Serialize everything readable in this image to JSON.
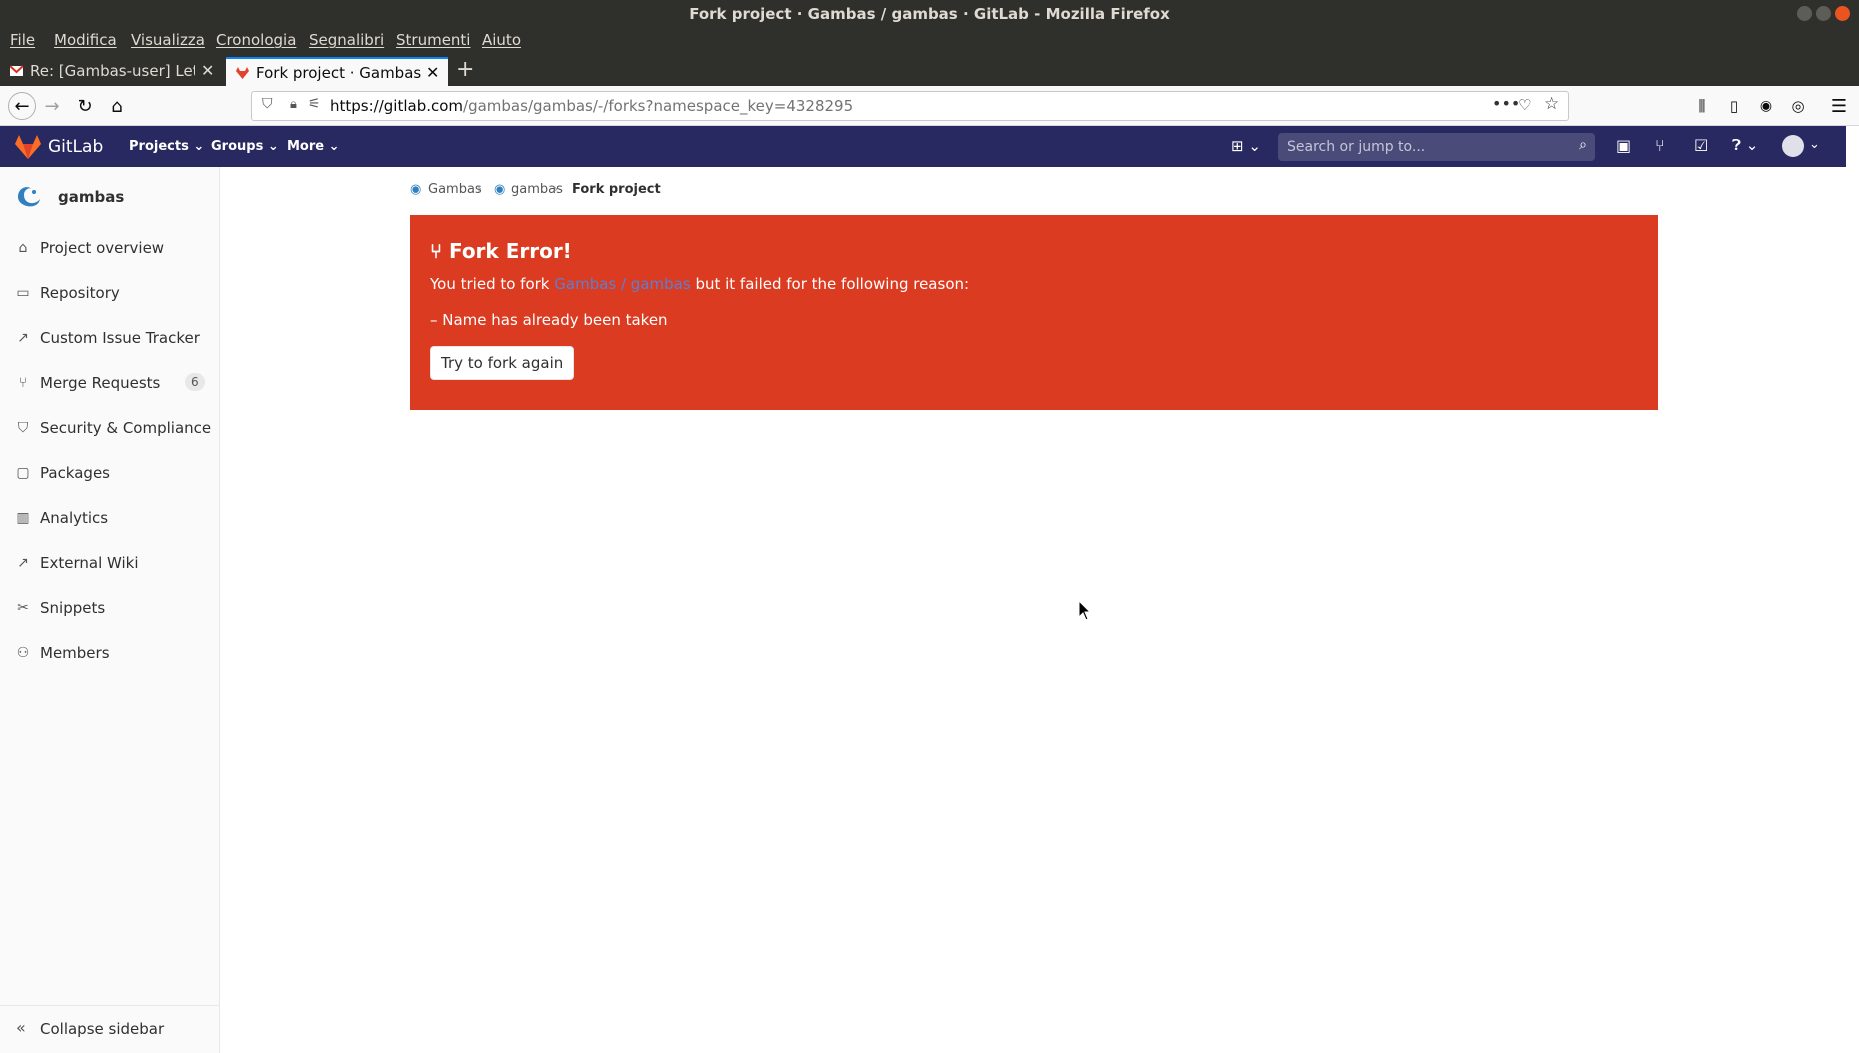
{
  "window": {
    "title": "Fork project · Gambas / gambas · GitLab - Mozilla Firefox"
  },
  "menubar": [
    "File",
    "Modifica",
    "Visualizza",
    "Cronologia",
    "Segnalibri",
    "Strumenti",
    "Aiuto"
  ],
  "tabs": [
    {
      "label": "Re: [Gambas-user] Let me",
      "active": false,
      "icon": "gmail-icon"
    },
    {
      "label": "Fork project · Gambas / g",
      "active": true,
      "icon": "gitlab-icon"
    }
  ],
  "urlbar": {
    "host": "https://gitlab.com",
    "path": "/gambas/gambas/-/forks?namespace_key=4328295"
  },
  "gitlab": {
    "brand": "GitLab",
    "nav": [
      "Projects",
      "Groups",
      "More"
    ],
    "search_placeholder": "Search or jump to..."
  },
  "sidebar": {
    "project_name": "gambas",
    "items": [
      {
        "label": "Project overview",
        "icon": "home-icon"
      },
      {
        "label": "Repository",
        "icon": "book-icon"
      },
      {
        "label": "Custom Issue Tracker",
        "icon": "external-link-icon"
      },
      {
        "label": "Merge Requests",
        "icon": "merge-request-icon",
        "badge": "6"
      },
      {
        "label": "Security & Compliance",
        "icon": "shield-icon"
      },
      {
        "label": "Packages",
        "icon": "package-icon"
      },
      {
        "label": "Analytics",
        "icon": "chart-icon"
      },
      {
        "label": "External Wiki",
        "icon": "external-link-icon"
      },
      {
        "label": "Snippets",
        "icon": "scissors-icon"
      },
      {
        "label": "Members",
        "icon": "users-icon"
      }
    ],
    "collapse_label": "Collapse sidebar"
  },
  "breadcrumb": {
    "group": "Gambas",
    "project": "gambas",
    "current": "Fork project"
  },
  "alert": {
    "title": "Fork Error!",
    "text_before": "You tried to fork ",
    "link": "Gambas / gambas",
    "text_after": " but it failed for the following reason:",
    "reason": "– Name has already been taken",
    "button": "Try to fork again",
    "bg_color": "#db3b21"
  },
  "colors": {
    "header": "#292961",
    "accent": "#fc6d26"
  }
}
